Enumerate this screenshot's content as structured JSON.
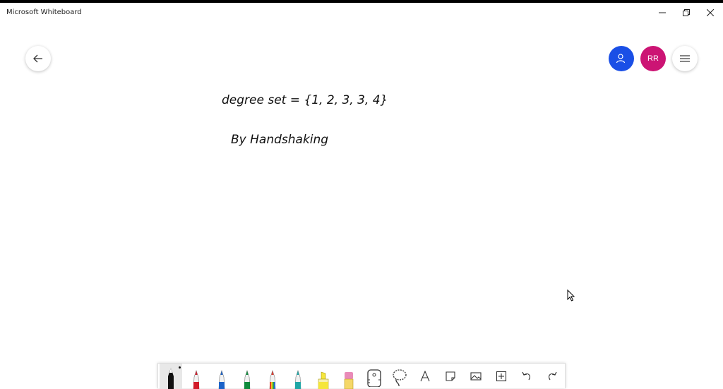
{
  "window": {
    "title": "Microsoft Whiteboard"
  },
  "header": {
    "avatar_initials": "RR"
  },
  "ink": {
    "line1": "degree set = {1, 2, 3, 3, 4}",
    "line2": "By Handshaking"
  },
  "toolbar": {
    "tools": [
      "black-pen",
      "red-pen",
      "blue-pen",
      "green-pen",
      "rainbow-pen",
      "teal-pen",
      "highlighter",
      "eraser",
      "ruler",
      "lasso",
      "text",
      "sticky-note",
      "image",
      "insert",
      "undo",
      "redo"
    ]
  },
  "colors": {
    "share_button": "#1a4fe6",
    "avatar": "#cc1474",
    "pen_black": "#111111",
    "pen_red": "#d21c2a",
    "pen_blue": "#1c63c8",
    "pen_green": "#0f8a3c",
    "pen_teal": "#1fa6a6",
    "highlighter": "#f5e63b",
    "eraser": "#e98bb8"
  }
}
